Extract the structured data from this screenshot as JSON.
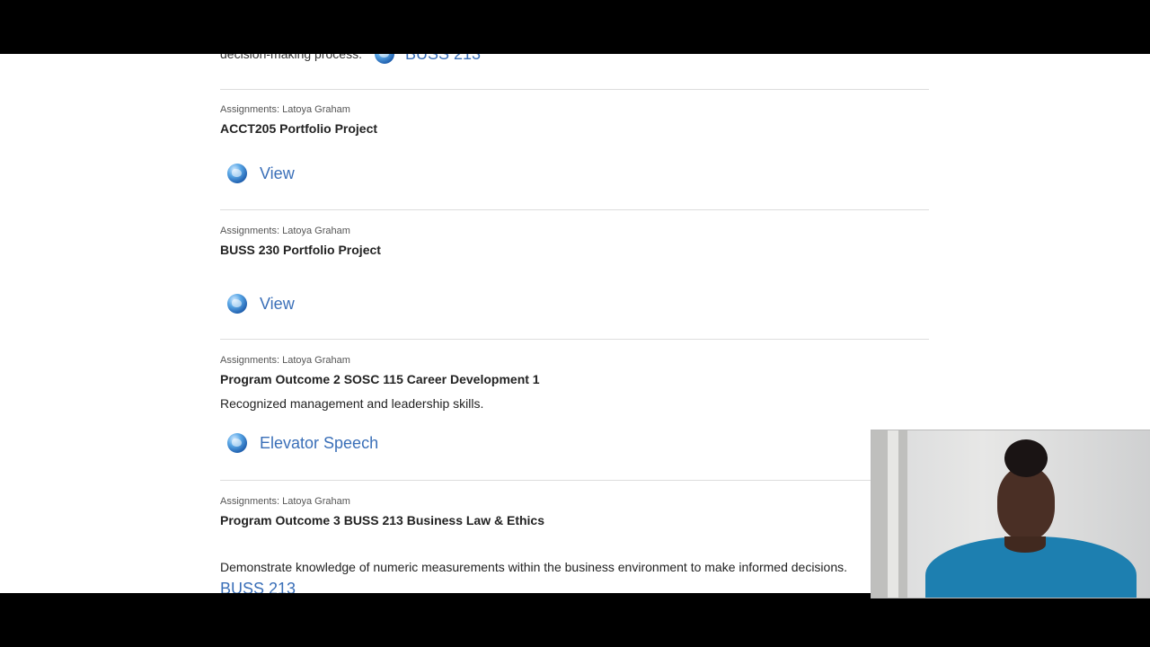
{
  "top_partial": {
    "text": "decision-making process.",
    "link_label": "BUSS 213"
  },
  "entries": [
    {
      "meta": "Assignments: Latoya Graham",
      "title": "ACCT205 Portfolio Project",
      "description": "",
      "link_label": "View"
    },
    {
      "meta": "Assignments: Latoya Graham",
      "title": "BUSS 230 Portfolio Project",
      "description": "",
      "link_label": "View"
    },
    {
      "meta": "Assignments: Latoya Graham",
      "title": "Program Outcome 2 SOSC 115 Career Development 1",
      "description": "Recognized management and leadership skills.",
      "link_label": "Elevator Speech"
    },
    {
      "meta": "Assignments: Latoya Graham",
      "title": "Program Outcome 3 BUSS 213 Business Law & Ethics",
      "description": "Demonstrate knowledge of numeric measurements within the business environment to make informed decisions.",
      "link_label": "BUSS 213"
    }
  ],
  "icons": {
    "link_icon": "globe-icon"
  }
}
